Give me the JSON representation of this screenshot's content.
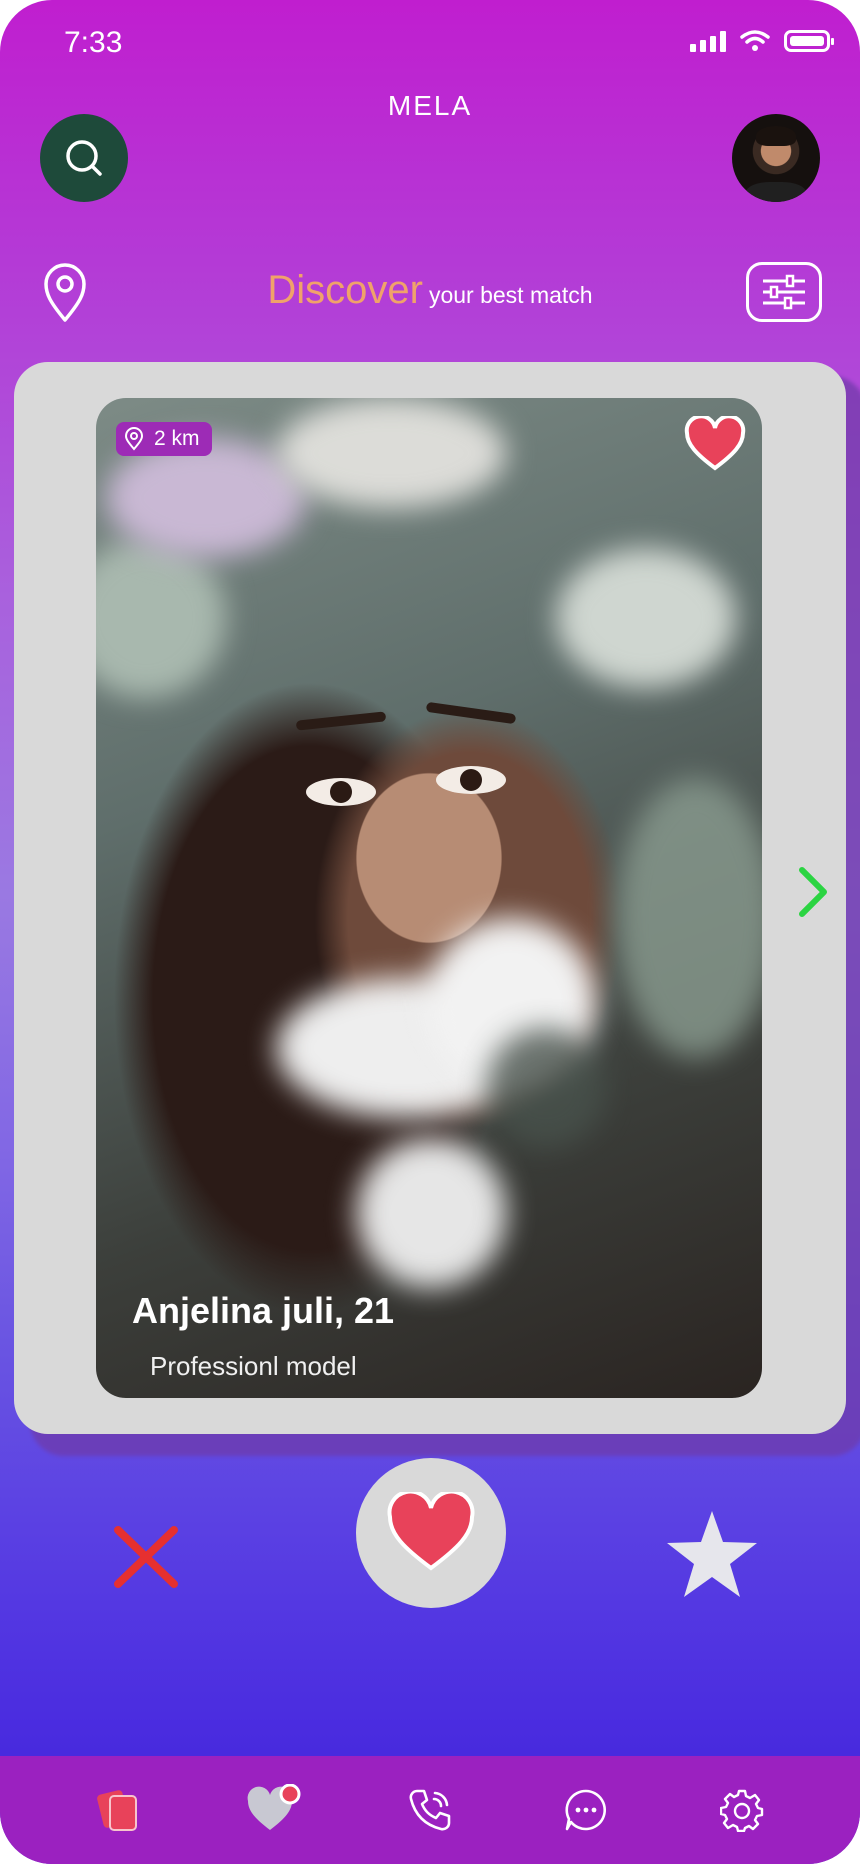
{
  "status": {
    "time": "7:33"
  },
  "header": {
    "logo": "MELA"
  },
  "discover": {
    "title": "Discover",
    "subtitle": "your best match"
  },
  "profile": {
    "distance": "2 km",
    "name": "Anjelina juli, 21",
    "occupation": "Professionl model"
  },
  "colors": {
    "accent": "#f0a26a",
    "like": "#e8425a",
    "dislike": "#e63030",
    "next": "#2bd442",
    "nav": "#9b21c0"
  },
  "icons": {
    "search": "search-icon",
    "location": "location-pin-icon",
    "filter": "sliders-icon",
    "heart": "heart-icon",
    "close": "close-icon",
    "star": "star-icon",
    "cards": "cards-icon",
    "likes": "heart-badge-icon",
    "calls": "phone-icon",
    "chat": "chat-icon",
    "settings": "gear-icon"
  }
}
